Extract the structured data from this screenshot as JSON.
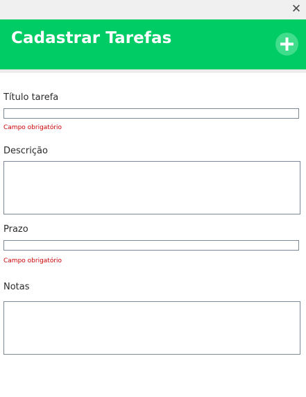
{
  "window": {
    "close_glyph": "✕"
  },
  "header": {
    "title": "Cadastrar Tarefas",
    "background_color": "#00cc66",
    "add_button_icon": "plus-icon"
  },
  "form": {
    "titulo": {
      "label": "Título tarefa",
      "value": "",
      "error": "Campo obrigatório"
    },
    "descricao": {
      "label": "Descrição",
      "value": ""
    },
    "prazo": {
      "label": "Prazo",
      "value": "",
      "error": "Campo obrigatório"
    },
    "notas": {
      "label": "Notas",
      "value": ""
    },
    "error_color": "#cc0000"
  }
}
